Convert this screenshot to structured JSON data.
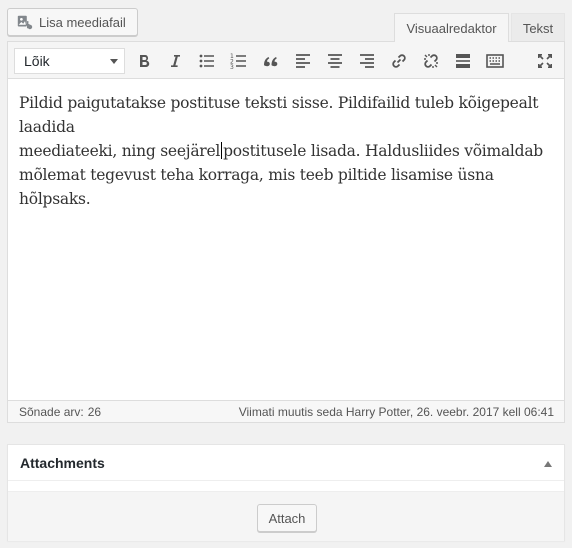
{
  "top": {
    "add_media_label": "Lisa meediafail",
    "tabs": [
      {
        "label": "Visuaalredaktor",
        "active": true
      },
      {
        "label": "Tekst",
        "active": false
      }
    ]
  },
  "toolbar": {
    "format_select_value": "Lõik",
    "buttons": [
      "bold-icon",
      "italic-icon",
      "bullet-list-icon",
      "numbered-list-icon",
      "blockquote-icon",
      "align-left-icon",
      "align-center-icon",
      "align-right-icon",
      "link-icon",
      "unlink-icon",
      "read-more-icon",
      "toolbar-toggle-icon",
      "fullscreen-icon"
    ]
  },
  "editor": {
    "text_line1": "Pildid paigutatakse postituse teksti sisse. Pildifailid tuleb kõigepealt laadida",
    "text_line2_before_caret": "meediateeki, ning seejärel",
    "text_line2_after_caret": "postitusele lisada. Haldusliides võimaldab",
    "text_line3": "mõlemat tegevust teha korraga, mis teeb piltide lisamise üsna hõlpsaks."
  },
  "status": {
    "word_count_label": "Sõnade arv:",
    "word_count": "26",
    "last_modified": "Viimati muutis seda Harry Potter, 26. veebr. 2017 kell 06:41"
  },
  "attachments": {
    "title": "Attachments",
    "attach_label": "Attach"
  }
}
